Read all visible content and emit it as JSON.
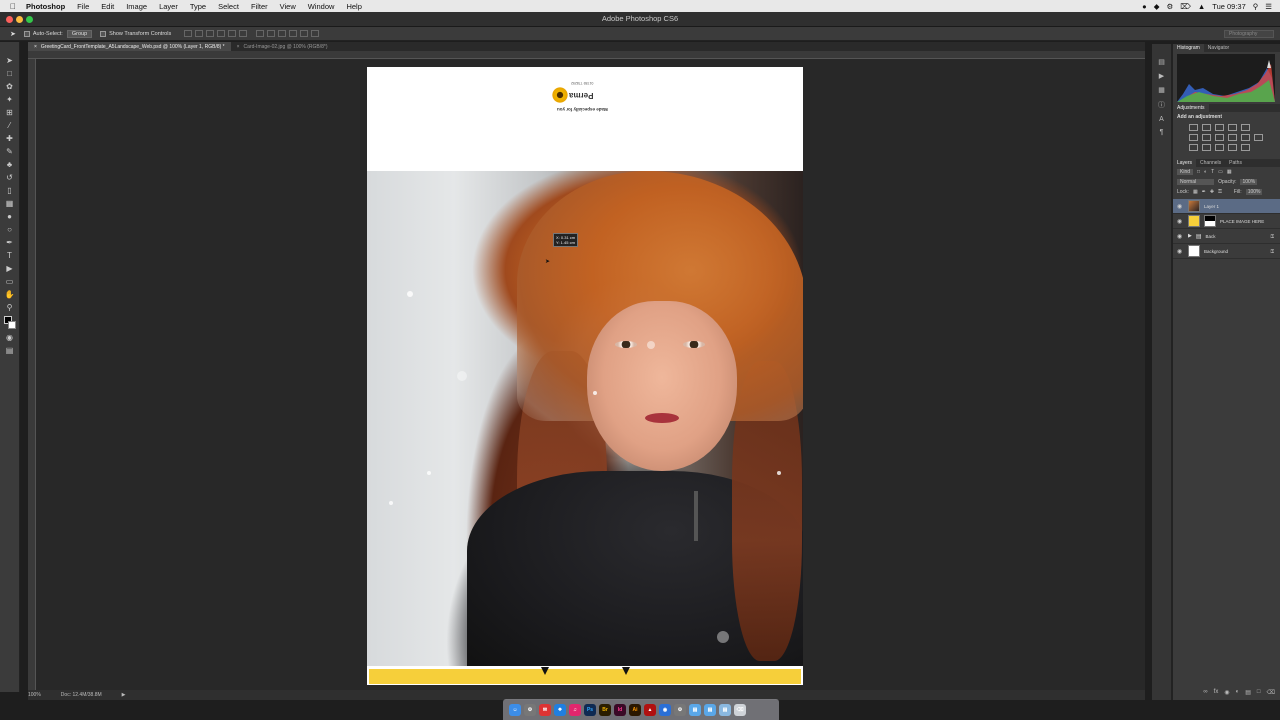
{
  "menubar": {
    "app_name": "Photoshop",
    "items": [
      "File",
      "Edit",
      "Image",
      "Layer",
      "Type",
      "Select",
      "Filter",
      "View",
      "Window",
      "Help"
    ],
    "clock": "Tue 09:37"
  },
  "window": {
    "title": "Adobe Photoshop CS6"
  },
  "options_bar": {
    "auto_select_label": "Auto-Select:",
    "auto_select_value": "Group",
    "transform_label": "Show Transform Controls",
    "workspace": "Photography"
  },
  "tabs": [
    {
      "label": "GreetingCard_FrontTemplate_A5Landscape_Web.psd @ 100% (Layer 1, RGB/8) *"
    },
    {
      "label": "Card-Image-02.jpg @ 100% (RGB/8*)"
    }
  ],
  "document": {
    "logo_name": "Perma",
    "logo_small": "01789 778292",
    "logo_tagline": "Made especially for you"
  },
  "move_tooltip": {
    "line1": "X: 0.31 cm",
    "line2": "Y: 1.45 cm"
  },
  "status": {
    "zoom": "100%",
    "doc": "Doc: 12.4M/38.8M"
  },
  "panels": {
    "histogram_tab": "Histogram",
    "navigator_tab": "Navigator",
    "adjustments_tab": "Adjustments",
    "adjustments_title": "Add an adjustment",
    "layers_tab": "Layers",
    "channels_tab": "Channels",
    "paths_tab": "Paths",
    "kind_label": "Kind",
    "blend_mode": "Normal",
    "opacity_label": "Opacity:",
    "opacity_value": "100%",
    "lock_label": "Lock:",
    "fill_label": "Fill:",
    "fill_value": "100%"
  },
  "layers": [
    {
      "name": "Layer 1",
      "selected": true
    },
    {
      "name": "PLACE IMAGE HERE",
      "selected": false
    },
    {
      "name": "Back",
      "selected": false
    },
    {
      "name": "Background",
      "selected": false
    }
  ],
  "colors": {
    "accent_yellow": "#f6cf3a",
    "selection_blue": "#5b6b85"
  }
}
